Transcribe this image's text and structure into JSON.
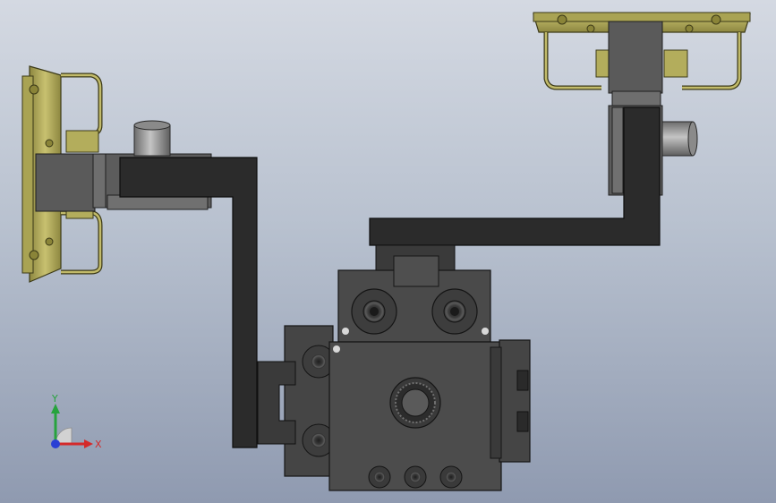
{
  "viewport": {
    "background_top": "#d4d9e2",
    "background_bottom": "#8f9ab0"
  },
  "colors": {
    "dark_part": "#2e2e2e",
    "mid_part": "#4f4f4f",
    "light_part": "#6e6e6e",
    "bracket_olive": "#b3ad5c",
    "bracket_olive_dark": "#6f6a2c",
    "cylinder_gray": "#9a9a9a",
    "axis_x": "#d42a2a",
    "axis_y": "#27a33d",
    "axis_z": "#2a3fd4"
  },
  "triad": {
    "x_label": "X",
    "y_label": "Y",
    "icon": "coordinate-triad-icon"
  }
}
